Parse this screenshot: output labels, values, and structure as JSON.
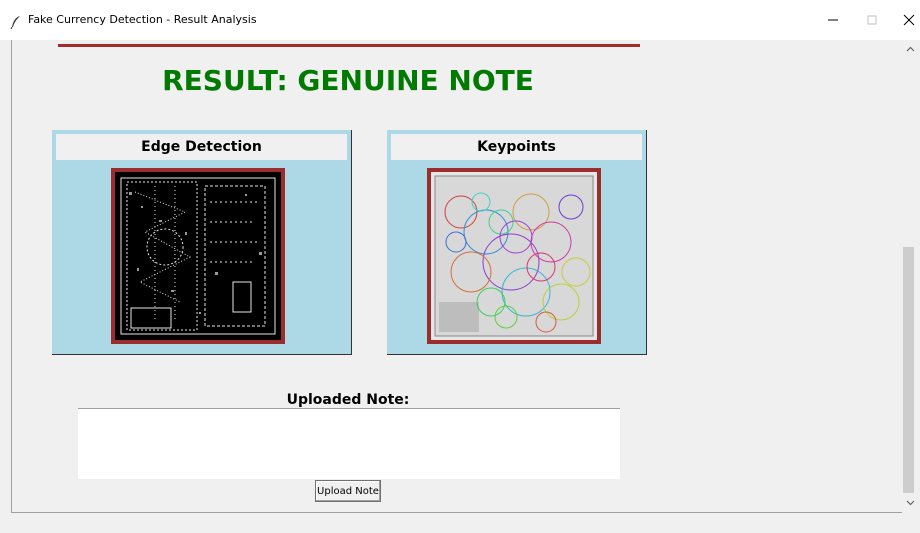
{
  "window": {
    "title": "Fake Currency Detection - Result Analysis",
    "icon": "feather-icon"
  },
  "result": {
    "text": "RESULT: GENUINE NOTE",
    "color": "#007a00",
    "rule_color": "#a52a2a"
  },
  "panels": [
    {
      "heading": "Edge Detection",
      "image": "edge-detection-image"
    },
    {
      "heading": "Keypoints",
      "image": "keypoints-image"
    }
  ],
  "upload": {
    "label": "Uploaded Note:",
    "button_label": "Upload Note",
    "note_text": ""
  },
  "colors": {
    "panel_bg": "#add8e6",
    "image_border": "#9b2d2d",
    "background": "#f0f0f0"
  },
  "scrollbar": {
    "position": 0.76
  }
}
